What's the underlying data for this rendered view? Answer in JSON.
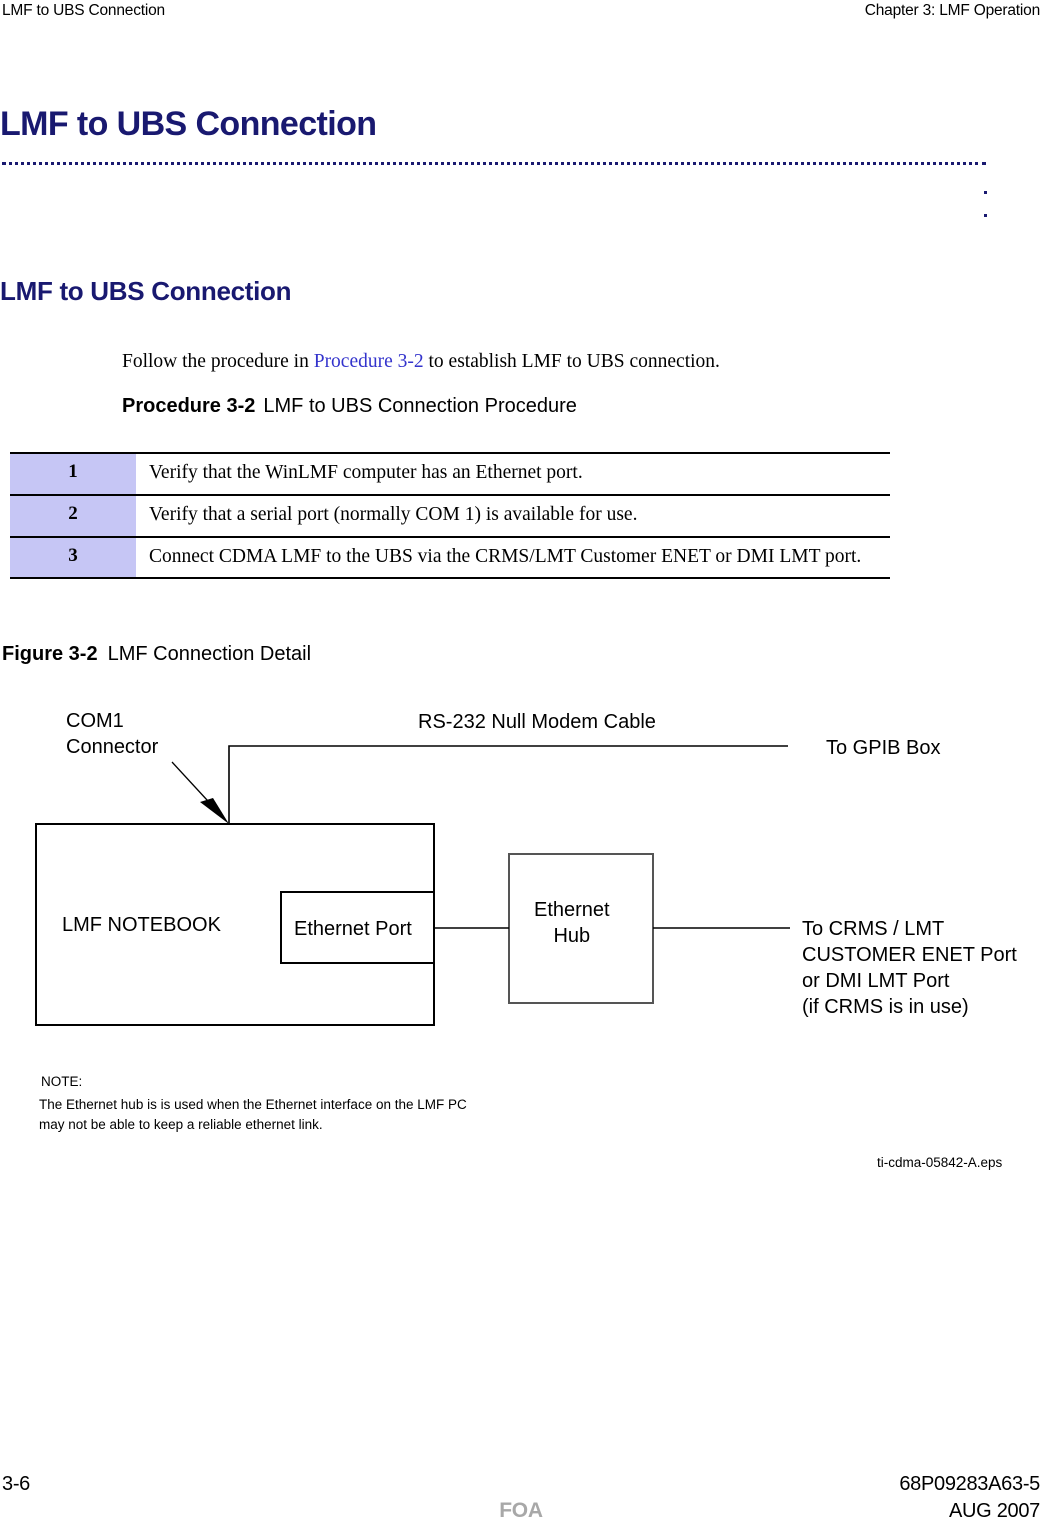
{
  "running_head": {
    "left": "LMF to UBS Connection",
    "right": "Chapter 3: LMF Operation"
  },
  "chapter": {
    "title": "LMF to UBS Connection"
  },
  "section": {
    "heading": "LMF to UBS Connection",
    "paragraph_before_link": "Follow the procedure in ",
    "paragraph_link": "Procedure 3-2",
    "paragraph_after_link": " to establish LMF to UBS connection."
  },
  "procedure": {
    "caption_label": "Procedure 3-2",
    "caption_text": "LMF to UBS Connection Procedure",
    "steps": [
      {
        "num": "1",
        "text": "Verify that the WinLMF computer has an Ethernet port."
      },
      {
        "num": "2",
        "text": "Verify that a serial port (normally COM 1) is available for use."
      },
      {
        "num": "3",
        "text": "Connect CDMA LMF to the UBS via the CRMS/LMT Customer ENET or DMI LMT port."
      }
    ]
  },
  "figure": {
    "caption_label": "Figure 3-2",
    "caption_text": "LMF Connection Detail",
    "labels": {
      "com1": "COM1\nConnector",
      "rs232": "RS-232 Null Modem Cable",
      "gpib": "To GPIB Box",
      "notebook": "LMF NOTEBOOK",
      "ethernet_port": "Ethernet Port",
      "ethernet_hub": "Ethernet\nHub",
      "crms": "To CRMS / LMT\nCUSTOMER ENET Port\nor DMI LMT Port\n(if CRMS is in use)"
    },
    "note_title": "NOTE:",
    "note_body": "The Ethernet hub is is used when the Ethernet interface on the LMF PC\nmay not be able to keep a reliable ethernet link.",
    "eps_name": "ti-cdma-05842-A.eps"
  },
  "footer": {
    "page": "3-6",
    "doc_number": "68P09283A63-5",
    "status": "FOA",
    "date": "AUG 2007"
  },
  "colors": {
    "heading": "#191970",
    "link": "#3333cc",
    "table_step_bg": "#c6c6f5",
    "footer_status": "#a8a8a8",
    "rule": "#000000"
  }
}
